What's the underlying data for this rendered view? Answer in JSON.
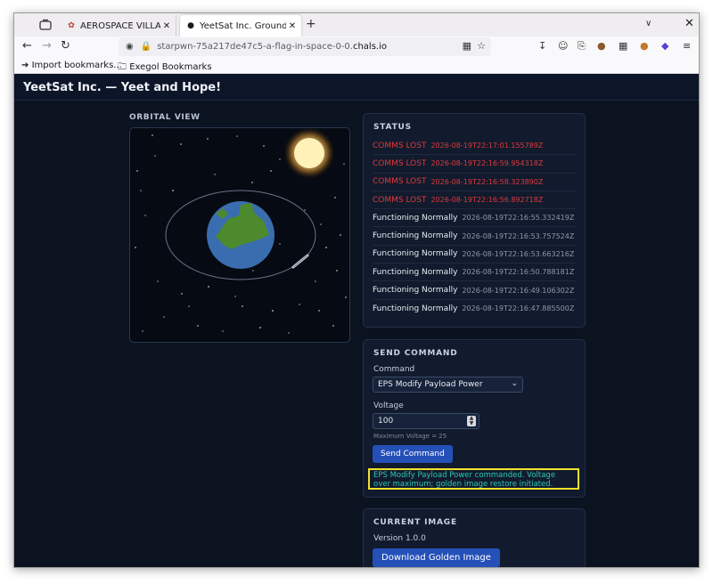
{
  "browser": {
    "tabs": [
      {
        "title": "AEROSPACE VILLAGE S",
        "active": false
      },
      {
        "title": "YeetSat Inc. Ground St",
        "active": true
      }
    ],
    "new_tab_symbol": "+",
    "url_prefix": "starpwn-75a217de47c5-a-flag-in-space-0-0.",
    "url_domain": "chals.io",
    "bookmarks": [
      {
        "label": "Import bookmarks...",
        "icon": "import-icon"
      },
      {
        "label": "Exegol Bookmarks",
        "icon": "folder-icon"
      }
    ]
  },
  "app": {
    "title": "YeetSat Inc. — Yeet and Hope!",
    "orbital_title": "ORBITAL VIEW"
  },
  "status": {
    "title": "STATUS",
    "entries": [
      {
        "label": "COMMS LOST",
        "time": "2026-08-19T22:17:01.155789Z",
        "state": "lost"
      },
      {
        "label": "COMMS LOST",
        "time": "2026-08-19T22:16:59.954318Z",
        "state": "lost"
      },
      {
        "label": "COMMS LOST",
        "time": "2026-08-19T22:16:58.323890Z",
        "state": "lost"
      },
      {
        "label": "COMMS LOST",
        "time": "2026-08-19T22:16:56.892718Z",
        "state": "lost"
      },
      {
        "label": "Functioning Normally",
        "time": "2026-08-19T22:16:55.332419Z",
        "state": "ok"
      },
      {
        "label": "Functioning Normally",
        "time": "2026-08-19T22:16:53.757524Z",
        "state": "ok"
      },
      {
        "label": "Functioning Normally",
        "time": "2026-08-19T22:16:53.663216Z",
        "state": "ok"
      },
      {
        "label": "Functioning Normally",
        "time": "2026-08-19T22:16:50.788181Z",
        "state": "ok"
      },
      {
        "label": "Functioning Normally",
        "time": "2026-08-19T22:16:49.106302Z",
        "state": "ok"
      },
      {
        "label": "Functioning Normally",
        "time": "2026-08-19T22:16:47.885500Z",
        "state": "ok"
      }
    ]
  },
  "command": {
    "title": "SEND COMMAND",
    "command_label": "Command",
    "command_value": "EPS Modify Payload Power",
    "voltage_label": "Voltage",
    "voltage_value": "100",
    "voltage_hint": "Maximum Voltage = 25",
    "send_label": "Send Command",
    "result": "EPS Modify Payload Power commanded. Voltage over maximum; golden image restore initiated."
  },
  "image": {
    "title": "CURRENT IMAGE",
    "version": "Version 1.0.0",
    "download_label": "Download Golden Image"
  },
  "colors": {
    "lost": "#e0383c",
    "accent": "#2450b8",
    "highlight": "#f2e12a",
    "result_text": "#2ec6b8"
  }
}
